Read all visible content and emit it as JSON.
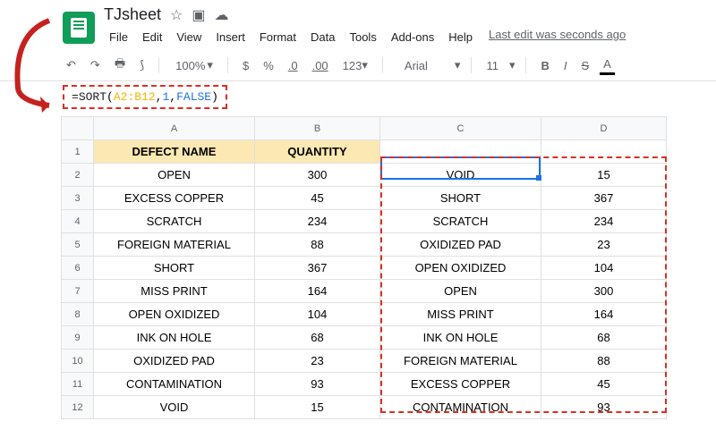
{
  "doc": {
    "title": "TJsheet",
    "last_edit": "Last edit was seconds ago"
  },
  "menu": {
    "file": "File",
    "edit": "Edit",
    "view": "View",
    "insert": "Insert",
    "format": "Format",
    "data": "Data",
    "tools": "Tools",
    "addons": "Add-ons",
    "help": "Help"
  },
  "toolbar": {
    "zoom": "100%",
    "currency": "$",
    "percent": "%",
    "dec_dec": ".0",
    "dec_inc": ".00",
    "fmt123": "123",
    "font": "Arial",
    "size": "11",
    "bold": "B",
    "italic": "I",
    "strike": "S",
    "textcolor": "A"
  },
  "formula": {
    "eq": "=",
    "fn": "SORT",
    "open": "(",
    "range": "A2:B12",
    "c1": ",",
    "arg1": "1",
    "c2": ",",
    "arg2": "FALSE",
    "close": ")"
  },
  "columns": {
    "A": "A",
    "B": "B",
    "C": "C",
    "D": "D"
  },
  "headers": {
    "name": "DEFECT NAME",
    "qty": "QUANTITY"
  },
  "rows": [
    {
      "n": "1"
    },
    {
      "n": "2",
      "a": "OPEN",
      "b": "300",
      "c": "VOID",
      "d": "15"
    },
    {
      "n": "3",
      "a": "EXCESS COPPER",
      "b": "45",
      "c": "SHORT",
      "d": "367"
    },
    {
      "n": "4",
      "a": "SCRATCH",
      "b": "234",
      "c": "SCRATCH",
      "d": "234"
    },
    {
      "n": "5",
      "a": "FOREIGN MATERIAL",
      "b": "88",
      "c": "OXIDIZED PAD",
      "d": "23"
    },
    {
      "n": "6",
      "a": "SHORT",
      "b": "367",
      "c": "OPEN OXIDIZED",
      "d": "104"
    },
    {
      "n": "7",
      "a": "MISS PRINT",
      "b": "164",
      "c": "OPEN",
      "d": "300"
    },
    {
      "n": "8",
      "a": "OPEN OXIDIZED",
      "b": "104",
      "c": "MISS PRINT",
      "d": "164"
    },
    {
      "n": "9",
      "a": "INK ON HOLE",
      "b": "68",
      "c": "INK ON HOLE",
      "d": "68"
    },
    {
      "n": "10",
      "a": "OXIDIZED PAD",
      "b": "23",
      "c": "FOREIGN MATERIAL",
      "d": "88"
    },
    {
      "n": "11",
      "a": "CONTAMINATION",
      "b": "93",
      "c": "EXCESS COPPER",
      "d": "45"
    },
    {
      "n": "12",
      "a": "VOID",
      "b": "15",
      "c": "CONTAMINATION",
      "d": "93"
    }
  ]
}
